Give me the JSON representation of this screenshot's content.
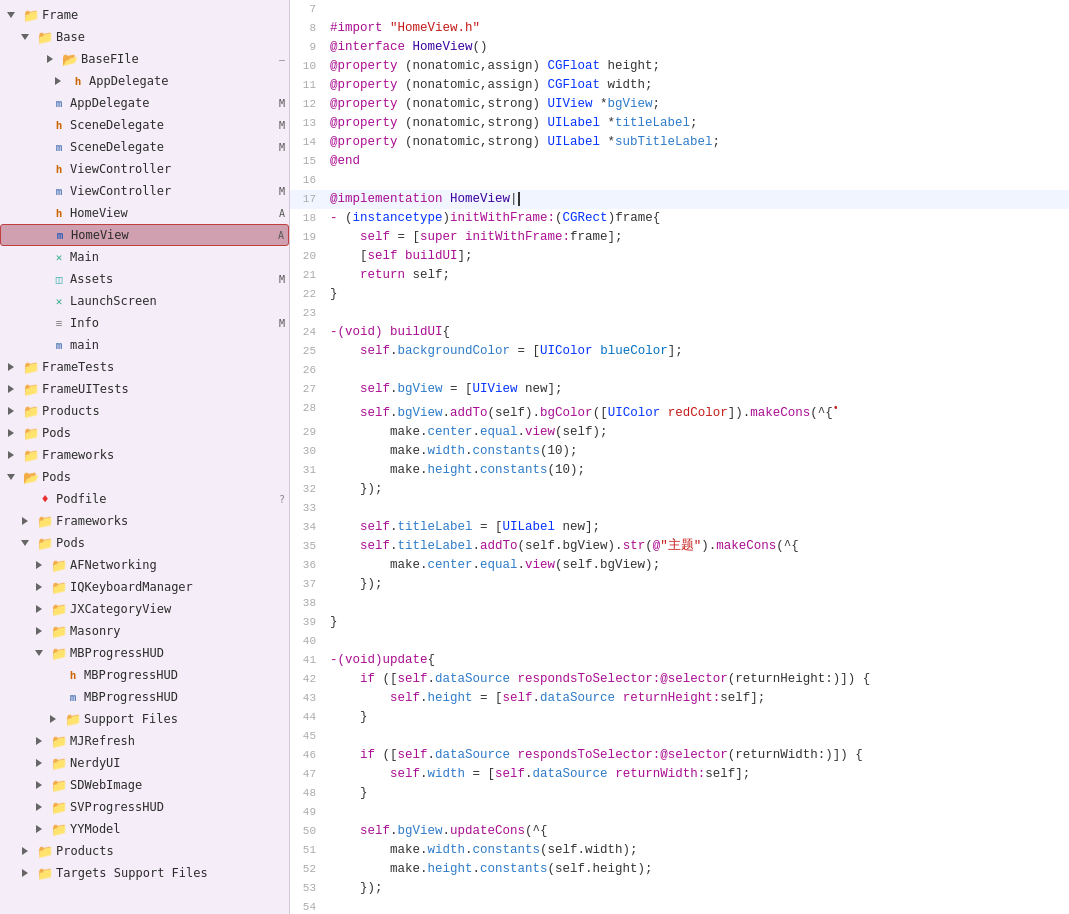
{
  "sidebar": {
    "items": [
      {
        "id": "frame",
        "label": "Frame",
        "indent": 0,
        "type": "folder-open",
        "color": "blue",
        "badge": ""
      },
      {
        "id": "base",
        "label": "Base",
        "indent": 1,
        "type": "folder-open",
        "color": "blue",
        "badge": ""
      },
      {
        "id": "basefile",
        "label": "BaseFIle",
        "indent": 2,
        "type": "file-group",
        "color": "gray",
        "badge": ""
      },
      {
        "id": "appdelegate-h",
        "label": "AppDelegate",
        "indent": 2,
        "type": "file-h",
        "color": "orange",
        "badge": ""
      },
      {
        "id": "appdelegate-m",
        "label": "AppDelegate",
        "indent": 2,
        "type": "file-m",
        "color": "blue",
        "badge": "M"
      },
      {
        "id": "scenedelegate-h",
        "label": "SceneDelegate",
        "indent": 2,
        "type": "file-h",
        "color": "orange",
        "badge": "M"
      },
      {
        "id": "scenedelegate-m",
        "label": "SceneDelegate",
        "indent": 2,
        "type": "file-m",
        "color": "blue",
        "badge": "M"
      },
      {
        "id": "viewcontroller-h",
        "label": "ViewController",
        "indent": 2,
        "type": "file-h",
        "color": "orange",
        "badge": ""
      },
      {
        "id": "viewcontroller-m",
        "label": "ViewController",
        "indent": 2,
        "type": "file-m",
        "color": "blue",
        "badge": "M"
      },
      {
        "id": "homeview-h",
        "label": "HomeView",
        "indent": 2,
        "type": "file-h",
        "color": "orange",
        "badge": "A"
      },
      {
        "id": "homeview-m",
        "label": "HomeView",
        "indent": 2,
        "type": "file-m",
        "color": "blue",
        "badge": "A",
        "selected": true
      },
      {
        "id": "main",
        "label": "Main",
        "indent": 2,
        "type": "file-storyboard",
        "color": "green",
        "badge": ""
      },
      {
        "id": "assets",
        "label": "Assets",
        "indent": 2,
        "type": "file-assets",
        "color": "teal",
        "badge": "M"
      },
      {
        "id": "launchscreen",
        "label": "LaunchScreen",
        "indent": 2,
        "type": "file-storyboard",
        "color": "green",
        "badge": ""
      },
      {
        "id": "info",
        "label": "Info",
        "indent": 2,
        "type": "file-info",
        "color": "gray",
        "badge": "M"
      },
      {
        "id": "main-c",
        "label": "main",
        "indent": 2,
        "type": "file-m",
        "color": "blue",
        "badge": ""
      },
      {
        "id": "frametests",
        "label": "FrameTests",
        "indent": 0,
        "type": "folder-closed",
        "color": "blue",
        "badge": ""
      },
      {
        "id": "frameutests",
        "label": "FrameUITests",
        "indent": 0,
        "type": "folder-closed",
        "color": "blue",
        "badge": ""
      },
      {
        "id": "products-1",
        "label": "Products",
        "indent": 0,
        "type": "folder-closed",
        "color": "blue",
        "badge": ""
      },
      {
        "id": "pods-1",
        "label": "Pods",
        "indent": 0,
        "type": "folder-closed",
        "color": "blue",
        "badge": ""
      },
      {
        "id": "frameworks-1",
        "label": "Frameworks",
        "indent": 0,
        "type": "folder-closed",
        "color": "blue",
        "badge": ""
      },
      {
        "id": "pods-root",
        "label": "Pods",
        "indent": 0,
        "type": "folder-open",
        "color": "blue-circle",
        "badge": ""
      },
      {
        "id": "podfile",
        "label": "Podfile",
        "indent": 1,
        "type": "file-pod",
        "color": "red",
        "badge": "?"
      },
      {
        "id": "frameworks-2",
        "label": "Frameworks",
        "indent": 1,
        "type": "folder-closed",
        "color": "blue",
        "badge": ""
      },
      {
        "id": "pods-sub",
        "label": "Pods",
        "indent": 1,
        "type": "folder-open",
        "color": "blue",
        "badge": ""
      },
      {
        "id": "afnetworking",
        "label": "AFNetworking",
        "indent": 2,
        "type": "folder-closed",
        "color": "blue",
        "badge": ""
      },
      {
        "id": "iqkeyboard",
        "label": "IQKeyboardManager",
        "indent": 2,
        "type": "folder-closed",
        "color": "blue",
        "badge": ""
      },
      {
        "id": "jxcategory",
        "label": "JXCategoryView",
        "indent": 2,
        "type": "folder-closed",
        "color": "blue",
        "badge": ""
      },
      {
        "id": "masonry",
        "label": "Masonry",
        "indent": 2,
        "type": "folder-closed",
        "color": "blue",
        "badge": ""
      },
      {
        "id": "mbprogress",
        "label": "MBProgressHUD",
        "indent": 2,
        "type": "folder-open",
        "color": "blue",
        "badge": ""
      },
      {
        "id": "mbprogress-h",
        "label": "MBProgressHUD",
        "indent": 3,
        "type": "file-h",
        "color": "orange",
        "badge": ""
      },
      {
        "id": "mbprogress-m",
        "label": "MBProgressHUD",
        "indent": 3,
        "type": "file-m",
        "color": "blue",
        "badge": ""
      },
      {
        "id": "support-files",
        "label": "Support Files",
        "indent": 3,
        "type": "folder-closed",
        "color": "blue",
        "badge": ""
      },
      {
        "id": "mjrefresh",
        "label": "MJRefresh",
        "indent": 2,
        "type": "folder-closed",
        "color": "blue",
        "badge": ""
      },
      {
        "id": "nerdyui",
        "label": "NerdyUI",
        "indent": 2,
        "type": "folder-closed",
        "color": "blue",
        "badge": ""
      },
      {
        "id": "sdwebimage",
        "label": "SDWebImage",
        "indent": 2,
        "type": "folder-closed",
        "color": "blue",
        "badge": ""
      },
      {
        "id": "svprogress",
        "label": "SVProgressHUD",
        "indent": 2,
        "type": "folder-closed",
        "color": "blue",
        "badge": ""
      },
      {
        "id": "yymodel",
        "label": "YYModel",
        "indent": 2,
        "type": "folder-closed",
        "color": "blue",
        "badge": ""
      },
      {
        "id": "products-2",
        "label": "Products",
        "indent": 1,
        "type": "folder-closed",
        "color": "blue",
        "badge": ""
      },
      {
        "id": "targets-support",
        "label": "Targets Support Files",
        "indent": 1,
        "type": "folder-closed",
        "color": "blue",
        "badge": ""
      }
    ]
  },
  "editor": {
    "filename": "HomeView.m"
  }
}
